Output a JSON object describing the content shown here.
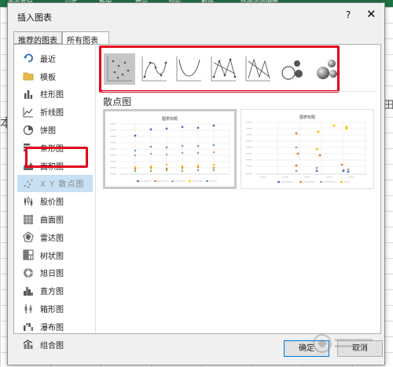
{
  "excel": {
    "menu": [
      "页面布局",
      "公式",
      "数据",
      "审阅",
      "视图",
      "帮助",
      "操作说明搜索"
    ],
    "left_cell_text": "本",
    "right_cell_text": "田"
  },
  "dialog": {
    "title": "插入图表",
    "help_label": "?",
    "close_label": "✕",
    "tabs": [
      {
        "label": "推荐的图表"
      },
      {
        "label": "所有图表"
      }
    ],
    "categories": [
      {
        "label": "最近",
        "icon": "recent-icon"
      },
      {
        "label": "模板",
        "icon": "folder-icon"
      },
      {
        "label": "柱形图",
        "icon": "column-chart-icon"
      },
      {
        "label": "折线图",
        "icon": "line-chart-icon"
      },
      {
        "label": "饼图",
        "icon": "pie-chart-icon"
      },
      {
        "label": "条形图",
        "icon": "bar-chart-icon"
      },
      {
        "label": "面积图",
        "icon": "area-chart-icon"
      },
      {
        "label": "X Y 散点图",
        "icon": "scatter-chart-icon"
      },
      {
        "label": "股价图",
        "icon": "stock-chart-icon"
      },
      {
        "label": "曲面图",
        "icon": "surface-chart-icon"
      },
      {
        "label": "雷达图",
        "icon": "radar-chart-icon"
      },
      {
        "label": "树状图",
        "icon": "treemap-chart-icon"
      },
      {
        "label": "旭日图",
        "icon": "sunburst-chart-icon"
      },
      {
        "label": "直方图",
        "icon": "histogram-chart-icon"
      },
      {
        "label": "箱形图",
        "icon": "box-whisker-chart-icon"
      },
      {
        "label": "瀑布图",
        "icon": "waterfall-chart-icon"
      },
      {
        "label": "组合图",
        "icon": "combo-chart-icon"
      }
    ],
    "selected_category": "X Y 散点图",
    "subtypes": [
      {
        "name": "scatter-icon"
      },
      {
        "name": "scatter-smooth-lines-markers-icon"
      },
      {
        "name": "scatter-smooth-lines-icon"
      },
      {
        "name": "scatter-straight-lines-markers-icon"
      },
      {
        "name": "scatter-straight-lines-icon"
      },
      {
        "name": "bubble-icon"
      },
      {
        "name": "bubble-3d-icon"
      }
    ],
    "section_title": "散点图",
    "preview_title": "图表标题",
    "ok_label": "确定",
    "cancel_label": "取消",
    "highlight_color": "#e3001b",
    "accent_color": "#0078d7"
  }
}
